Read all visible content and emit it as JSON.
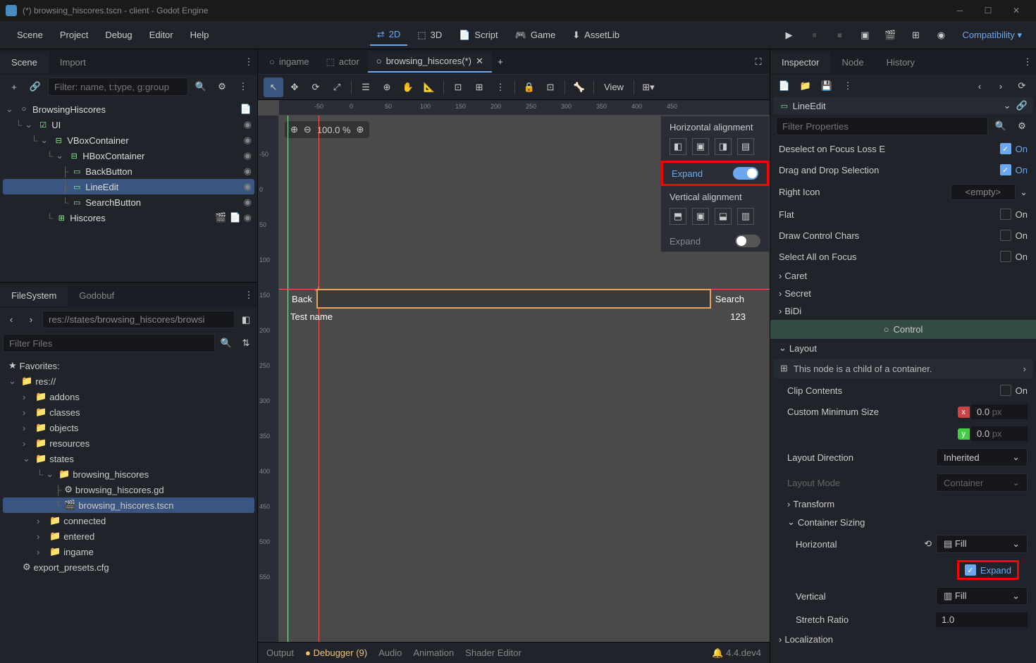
{
  "titlebar": {
    "title": "(*) browsing_hiscores.tscn - client - Godot Engine"
  },
  "menubar": {
    "items": [
      "Scene",
      "Project",
      "Debug",
      "Editor",
      "Help"
    ],
    "workspaces": {
      "2d": "2D",
      "3d": "3D",
      "script": "Script",
      "game": "Game",
      "assetlib": "AssetLib"
    },
    "compat": "Compatibility"
  },
  "scene_panel": {
    "tabs": {
      "scene": "Scene",
      "import": "Import"
    },
    "filter_placeholder": "Filter: name, t:type, g:group",
    "tree": {
      "root": "BrowsingHiscores",
      "ui": "UI",
      "vbox": "VBoxContainer",
      "hbox": "HBoxContainer",
      "back": "BackButton",
      "lineedit": "LineEdit",
      "search": "SearchButton",
      "hiscores": "Hiscores"
    }
  },
  "filesystem": {
    "tabs": {
      "fs": "FileSystem",
      "godobuf": "Godobuf"
    },
    "path": "res://states/browsing_hiscores/browsi",
    "filter_placeholder": "Filter Files",
    "favorites": "Favorites:",
    "tree": {
      "res": "res://",
      "addons": "addons",
      "classes": "classes",
      "objects": "objects",
      "resources": "resources",
      "states": "states",
      "browsing_hiscores": "browsing_hiscores",
      "gd_file": "browsing_hiscores.gd",
      "tscn_file": "browsing_hiscores.tscn",
      "connected": "connected",
      "entered": "entered",
      "ingame": "ingame",
      "export_presets": "export_presets.cfg"
    }
  },
  "editor": {
    "tabs": {
      "ingame": "ingame",
      "actor": "actor",
      "browsing": "browsing_hiscores(*)"
    },
    "view_label": "View",
    "zoom": "100.0 %",
    "preview": {
      "back": "Back",
      "search": "Search",
      "test_name": "Test name",
      "test_val": "123"
    }
  },
  "align_popup": {
    "h_title": "Horizontal alignment",
    "expand": "Expand",
    "v_title": "Vertical alignment"
  },
  "bottom": {
    "output": "Output",
    "debugger": "Debugger (9)",
    "audio": "Audio",
    "animation": "Animation",
    "shader": "Shader Editor",
    "version": "4.4.dev4"
  },
  "inspector": {
    "tabs": {
      "inspector": "Inspector",
      "node": "Node",
      "history": "History"
    },
    "node_type": "LineEdit",
    "filter_placeholder": "Filter Properties",
    "props": {
      "deselect": "Deselect on Focus Loss E",
      "drag_drop": "Drag and Drop Selection",
      "right_icon": "Right Icon",
      "right_icon_val": "<empty>",
      "flat": "Flat",
      "draw_chars": "Draw Control Chars",
      "select_all": "Select All on Focus",
      "caret": "Caret",
      "secret": "Secret",
      "bidi": "BiDi",
      "layout": "Layout",
      "control": "Control",
      "container_hint": "This node is a child of a container.",
      "clip_contents": "Clip Contents",
      "custom_min": "Custom Minimum Size",
      "layout_dir": "Layout Direction",
      "layout_dir_val": "Inherited",
      "layout_mode": "Layout Mode",
      "layout_mode_val": "Container",
      "transform": "Transform",
      "container_sizing": "Container Sizing",
      "horizontal": "Horizontal",
      "fill": "Fill",
      "expand": "Expand",
      "vertical": "Vertical",
      "stretch": "Stretch Ratio",
      "stretch_val": "1.0",
      "localization": "Localization",
      "on": "On",
      "zero": "0.0",
      "px": "px"
    }
  }
}
